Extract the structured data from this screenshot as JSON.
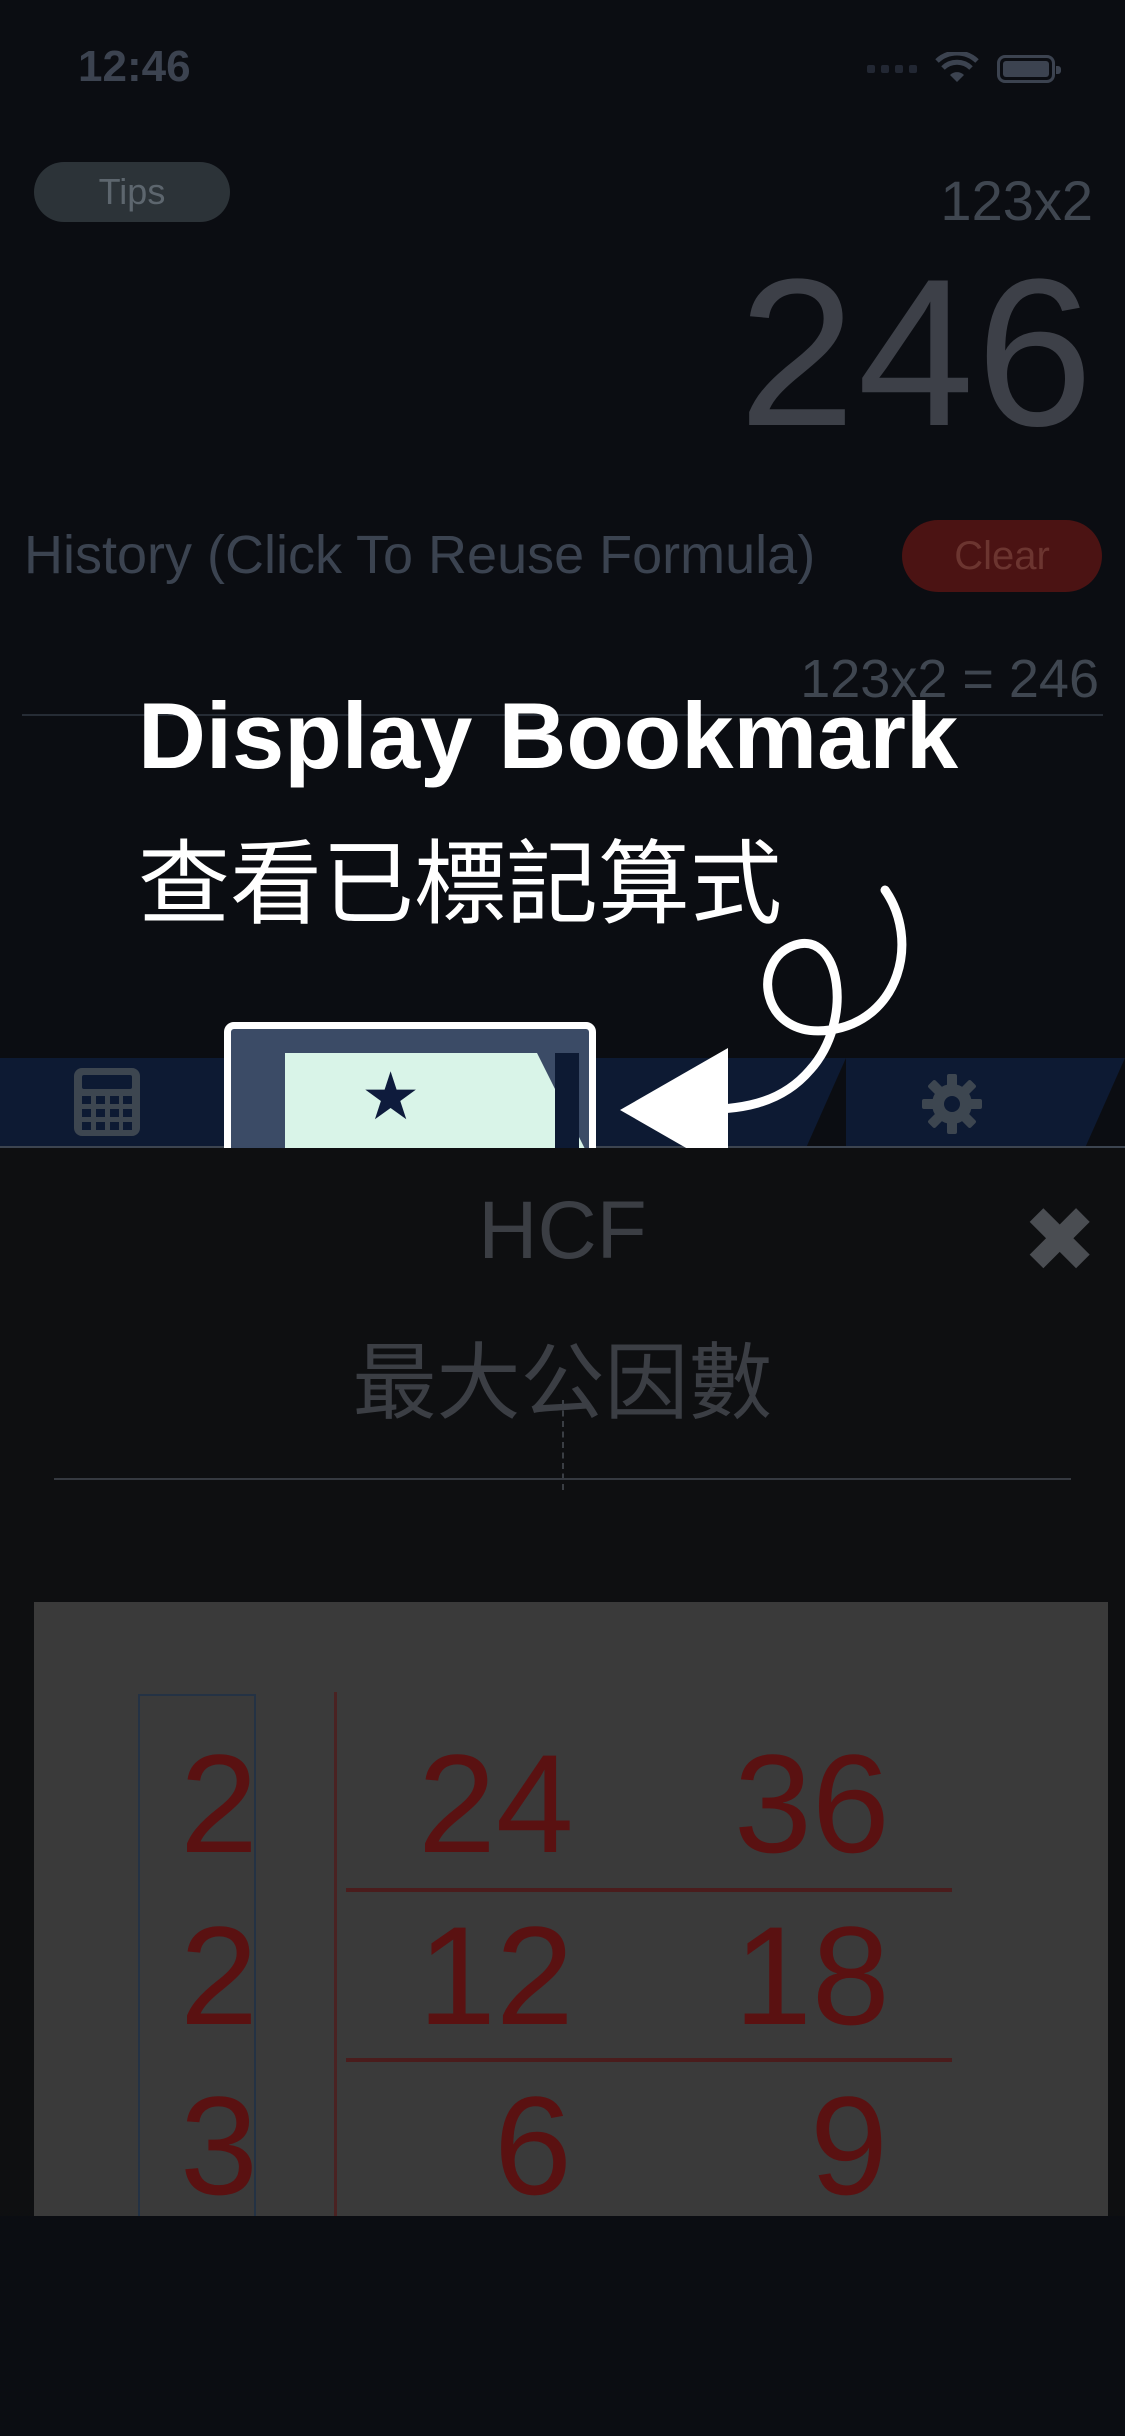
{
  "status_bar": {
    "time": "12:46"
  },
  "calculator": {
    "tips_label": "Tips",
    "expression": "123x2",
    "result": "246",
    "history_label": "History (Click To Reuse Formula)",
    "clear_label": "Clear",
    "history_items": [
      "123x2 = 246"
    ]
  },
  "tab_bar": {
    "tabs": [
      {
        "icon": "calculator-icon"
      },
      {
        "icon": "star-icon",
        "highlighted": true
      },
      {
        "icon": "gear-icon"
      }
    ]
  },
  "callout": {
    "title_en": "Display Bookmark",
    "title_zh": "查看已標記算式"
  },
  "panel": {
    "title": "HCF",
    "subtitle": "最大公因數",
    "close_icon": "close-icon",
    "ladder": {
      "divisors": [
        "2",
        "2",
        "3"
      ],
      "rows": [
        [
          "24",
          "36"
        ],
        [
          "12",
          "18"
        ],
        [
          "6",
          "9"
        ]
      ]
    }
  },
  "colors": {
    "background": "#0b0d12",
    "tab_bar": "#0d1a33",
    "bookmark_fill": "#d9f4e8",
    "ladder_text": "#5a1111"
  }
}
